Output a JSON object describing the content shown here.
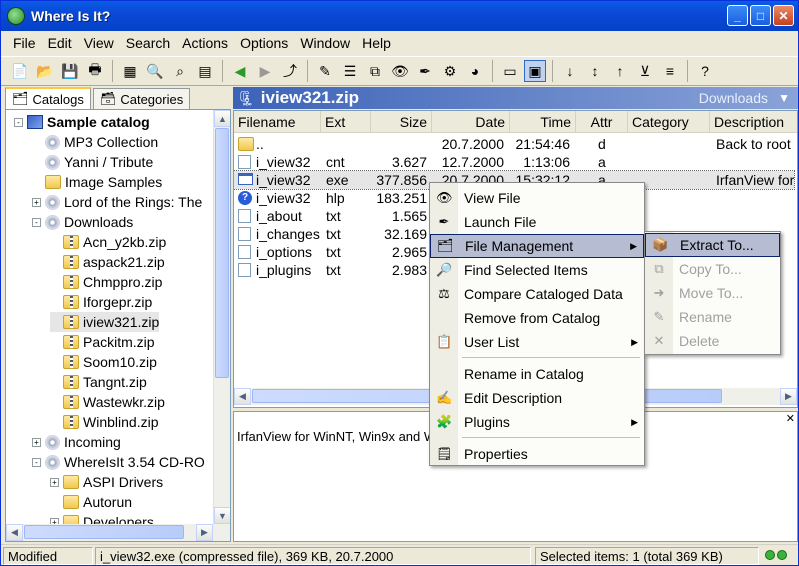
{
  "window": {
    "title": "Where Is It?"
  },
  "menubar": [
    "File",
    "Edit",
    "View",
    "Search",
    "Actions",
    "Options",
    "Window",
    "Help"
  ],
  "toolbar_icons": [
    "new-icon",
    "open-icon",
    "save-icon",
    "print-icon",
    "catalog-icon",
    "search-icon",
    "find-icon",
    "report-icon",
    "back-icon",
    "forward-icon",
    "up-icon",
    "edit-icon",
    "properties-icon",
    "view-icon",
    "eye-icon",
    "pen-icon",
    "plugin-icon",
    "color-icon",
    "list-view-icon",
    "thumbnail-icon",
    "sort-az-icon",
    "sort-num-icon",
    "sort-za-icon",
    "filter-icon",
    "sort-text-icon",
    "help-icon"
  ],
  "tabs": {
    "catalogs": "Catalogs",
    "categories": "Categories"
  },
  "tree": [
    {
      "label": "Sample catalog",
      "bold": true,
      "icon": "catalog"
    },
    {
      "label": "MP3 Collection",
      "icon": "cd"
    },
    {
      "label": "Yanni / Tribute",
      "icon": "cd"
    },
    {
      "label": "Image Samples",
      "icon": "folder"
    },
    {
      "label": "Lord of the Rings: The",
      "icon": "cd"
    },
    {
      "label": "Downloads",
      "icon": "cd"
    },
    {
      "label": "Acn_y2kb.zip",
      "icon": "zip"
    },
    {
      "label": "aspack21.zip",
      "icon": "zip"
    },
    {
      "label": "Chmppro.zip",
      "icon": "zip"
    },
    {
      "label": "Iforgepr.zip",
      "icon": "zip"
    },
    {
      "label": "iview321.zip",
      "icon": "zip"
    },
    {
      "label": "Packitm.zip",
      "icon": "zip"
    },
    {
      "label": "Soom10.zip",
      "icon": "zip"
    },
    {
      "label": "Tangnt.zip",
      "icon": "zip"
    },
    {
      "label": "Wastewkr.zip",
      "icon": "zip"
    },
    {
      "label": "Winblind.zip",
      "icon": "zip"
    },
    {
      "label": "Incoming",
      "icon": "cd"
    },
    {
      "label": "WhereIsIt 3.54 CD-RO",
      "icon": "cd"
    },
    {
      "label": "ASPI Drivers",
      "icon": "folder"
    },
    {
      "label": "Autorun",
      "icon": "folder"
    },
    {
      "label": "Developers",
      "icon": "folder"
    }
  ],
  "path": {
    "title": "iview321.zip",
    "location": "Downloads"
  },
  "columns": [
    "Filename",
    "Ext",
    "Size",
    "Date",
    "Time",
    "Attr",
    "Category",
    "Description"
  ],
  "files": [
    {
      "name": "..",
      "ext": "",
      "size": "",
      "date": "20.7.2000",
      "time": "21:54:46",
      "attr": "d",
      "desc": "Back to root",
      "icon": "folder"
    },
    {
      "name": "i_view32",
      "ext": "cnt",
      "size": "3.627",
      "date": "12.7.2000",
      "time": "1:13:06",
      "attr": "a",
      "desc": "",
      "icon": "file"
    },
    {
      "name": "i_view32",
      "ext": "exe",
      "size": "377.856",
      "date": "20.7.2000",
      "time": "15:32:12",
      "attr": "a",
      "desc": "IrfanView for",
      "icon": "exe"
    },
    {
      "name": "i_view32",
      "ext": "hlp",
      "size": "183.251",
      "date": "",
      "time": "",
      "attr": "",
      "desc": "",
      "icon": "hlp"
    },
    {
      "name": "i_about",
      "ext": "txt",
      "size": "1.565",
      "date": "",
      "time": "",
      "attr": "",
      "desc": "",
      "icon": "file"
    },
    {
      "name": "i_changes",
      "ext": "txt",
      "size": "32.169",
      "date": "",
      "time": "",
      "attr": "",
      "desc": "",
      "icon": "file"
    },
    {
      "name": "i_options",
      "ext": "txt",
      "size": "2.965",
      "date": "",
      "time": "",
      "attr": "",
      "desc": "",
      "icon": "file"
    },
    {
      "name": "i_plugins",
      "ext": "txt",
      "size": "2.983",
      "date": "",
      "time": "",
      "attr": "",
      "desc": "",
      "icon": "file"
    }
  ],
  "description": "IrfanView for WinNT, Win9x and W",
  "context_menu": [
    {
      "label": "View File",
      "icon": "eye-icon"
    },
    {
      "label": "Launch File",
      "icon": "pen-icon"
    },
    {
      "label": "File Management",
      "icon": "file-manage-icon",
      "submenu": true
    },
    {
      "label": "Find Selected Items",
      "icon": "find-icon"
    },
    {
      "label": "Compare Cataloged Data",
      "icon": "compare-icon"
    },
    {
      "label": "Remove from Catalog",
      "icon": ""
    },
    {
      "label": "User List",
      "icon": "user-list-icon",
      "submenu": true
    },
    {
      "label": "Rename in Catalog",
      "icon": ""
    },
    {
      "label": "Edit Description",
      "icon": "edit-desc-icon"
    },
    {
      "label": "Plugins",
      "icon": "plugin-icon",
      "submenu": true
    },
    {
      "label": "Properties",
      "icon": "properties-icon"
    }
  ],
  "submenu": [
    {
      "label": "Extract To...",
      "enabled": true
    },
    {
      "label": "Copy To...",
      "enabled": false
    },
    {
      "label": "Move To...",
      "enabled": false
    },
    {
      "label": "Rename",
      "enabled": false
    },
    {
      "label": "Delete",
      "enabled": false
    }
  ],
  "status": {
    "mode": "Modified",
    "file": "i_view32.exe (compressed file), 369 KB, 20.7.2000",
    "selected": "Selected items: 1 (total 369 KB)"
  },
  "colors": {
    "titlebar": "#0a5ce6",
    "path_bar": "#3c63b8",
    "menu_highlight": "#b6bdd2"
  }
}
